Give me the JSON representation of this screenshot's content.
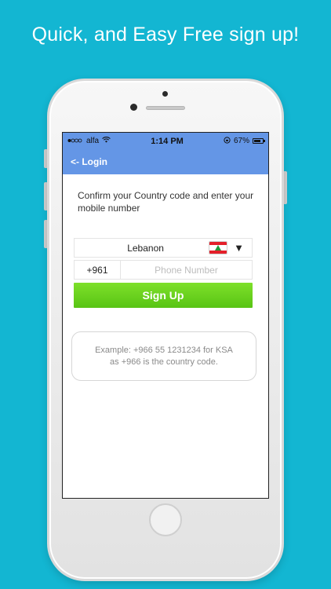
{
  "headline": "Quick, and Easy Free sign up!",
  "status": {
    "carrier": "alfa",
    "time": "1:14 PM",
    "battery": "67%"
  },
  "nav": {
    "back_label": "<- Login"
  },
  "form": {
    "instructions": "Confirm your Country code and enter your mobile number",
    "country_name": "Lebanon",
    "country_code": "+961",
    "phone_placeholder": "Phone Number",
    "phone_value": "",
    "submit_label": "Sign Up"
  },
  "example": {
    "line1": "Example: +966 55 1231234 for KSA",
    "line2": "as +966 is the country code."
  },
  "icons": {
    "signal": "signal-dots-icon",
    "wifi": "wifi-icon",
    "orientation_lock": "orientation-lock-icon",
    "battery": "battery-icon",
    "flag": "lebanon-flag-icon",
    "dropdown": "dropdown-arrow-icon"
  },
  "colors": {
    "background": "#13b6d2",
    "nav_bar": "#6496e6",
    "signup_button": "#58c414"
  }
}
